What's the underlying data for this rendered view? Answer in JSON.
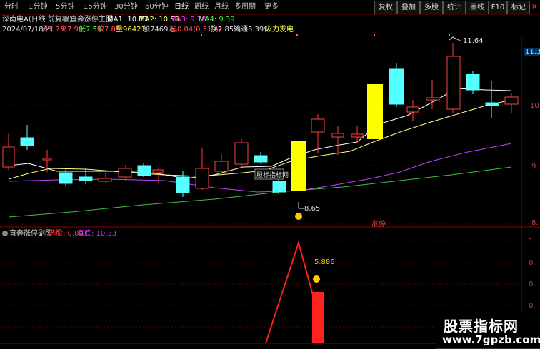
{
  "toolbar": {
    "periods": [
      "分时",
      "1分钟",
      "5分钟",
      "15分钟",
      "30分钟",
      "60分钟",
      "日线",
      "周线",
      "月线",
      "多周期",
      "更多"
    ],
    "active": "日线",
    "right_buttons": [
      "复权",
      "叠加",
      "多股",
      "统计",
      "画线",
      "F10",
      "标记"
    ],
    "close": "×"
  },
  "main_header": {
    "stock": "深南电A(日线 前复权)",
    "indicator": "直奔涨停主图",
    "ma1": "MA1: 10.73",
    "ma2": "MA2: 10.53",
    "ma3": "MA3: 9.78",
    "ma4": "MA4: 9.39"
  },
  "quote": {
    "date": "2024/07/18/四",
    "open": "开7.73",
    "high": "高7.90",
    "low": "低7.59",
    "close": "收7.85",
    "volume": "量96421",
    "amount": "额7469万",
    "change": "幅0.04(0.51%)",
    "turnover": "换2.85%",
    "float": "流通3.39亿",
    "tag": "火力发电"
  },
  "y_axis_main": [
    "11.30",
    "10.",
    "9.",
    "8."
  ],
  "y_axis_sub": [
    "1.",
    "0.",
    "0.",
    "0.",
    "0."
  ],
  "annotations": {
    "high": "11.64",
    "low": "8.65",
    "label_box": "股标指标网",
    "zhangting": "涨停",
    "sub_value": "5.886",
    "sub_icon": "☺"
  },
  "sub_header": {
    "indicator": "直奔涨停副图",
    "a_label": "选股: 0.00",
    "b_label": "真底: 10.33"
  },
  "watermark": {
    "line1": "股票指标网",
    "line2": "www.7gpzb.com"
  },
  "colors": {
    "up": "#ff4040",
    "down": "#54ffff",
    "yellow": "#ffff00",
    "ma1": "#ffffff",
    "ma2": "#ffff80",
    "ma3": "#ff40ff",
    "ma4": "#40ff40"
  }
}
